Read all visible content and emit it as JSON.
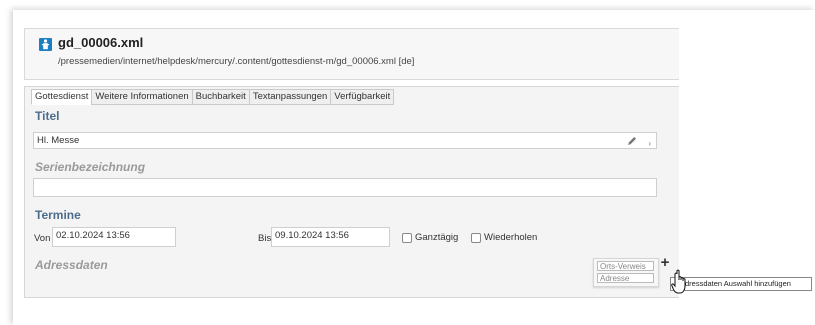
{
  "header": {
    "file_name": "gd_00006.xml",
    "path": "/pressemedien/internet/helpdesk/mercury/.content/gottesdienst-m/gd_00006.xml [de]"
  },
  "tabs": [
    {
      "label": "Gottesdienst",
      "active": true
    },
    {
      "label": "Weitere Informationen",
      "active": false
    },
    {
      "label": "Buchbarkeit",
      "active": false
    },
    {
      "label": "Textanpassungen",
      "active": false
    },
    {
      "label": "Verfügbarkeit",
      "active": false
    }
  ],
  "form": {
    "titel_label": "Titel",
    "titel_value": "Hl. Messe",
    "serien_label": "Serienbezeichnung",
    "serien_value": "",
    "termine_label": "Termine",
    "von_label": "Von",
    "von_value": "02.10.2024 13:56",
    "bis_label": "Bis",
    "bis_value": "09.10.2024 13:56",
    "ganztaegig_label": "Ganztägig",
    "wiederholen_label": "Wiederholen",
    "adress_label": "Adressdaten"
  },
  "add_menu": {
    "items": [
      "Orts-Verweis",
      "Adresse"
    ],
    "tooltip": "dressdaten Auswahl hinzufügen"
  },
  "colors": {
    "section_label": "#4d6d8c",
    "icon_blue": "#1c7fc4"
  }
}
